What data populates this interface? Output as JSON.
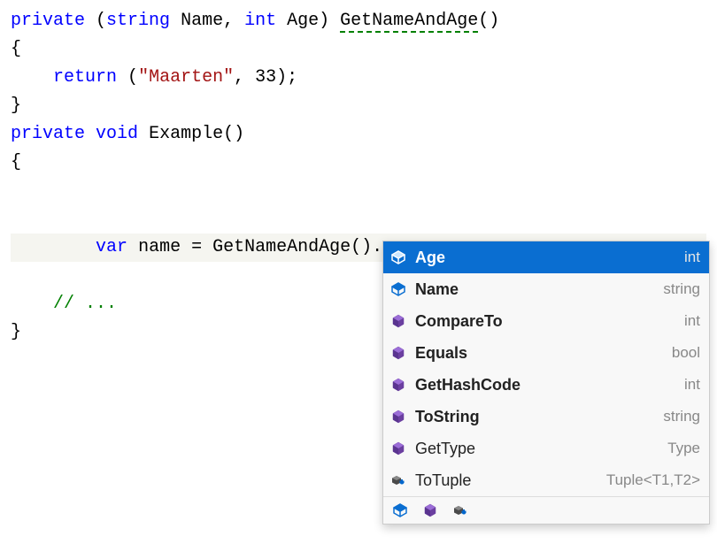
{
  "code": {
    "line1": {
      "kw_private": "private",
      "paren_open": "(",
      "type_string": "string",
      "name_label": "Name",
      "comma": ", ",
      "type_int": "int",
      "age_label": "Age",
      "paren_close": ") ",
      "method": "GetNameAndAge",
      "parens": "()"
    },
    "line2": "{",
    "line3": {
      "indent": "    ",
      "kw_return": "return",
      "space": " ",
      "paren_open": "(",
      "str": "\"Maarten\"",
      "comma": ", ",
      "num": "33",
      "paren_close": ");"
    },
    "line4": "}",
    "line5": "",
    "line6": {
      "kw_private": "private",
      "space": " ",
      "kw_void": "void",
      "space2": " ",
      "method": "Example",
      "parens": "()"
    },
    "line7": "{",
    "line8": {
      "indent": "    ",
      "kw_var": "var",
      "space": " ",
      "ident": "name",
      "eq": " = ",
      "call": "GetNameAndAge().",
      "squiggle": ""
    },
    "line9": "",
    "line10": {
      "indent": "    ",
      "comment": "// ..."
    },
    "line11": "}"
  },
  "intellisense": {
    "items": [
      {
        "icon": "field",
        "label": "Age",
        "type": "int",
        "bold": true,
        "selected": true
      },
      {
        "icon": "field",
        "label": "Name",
        "type": "string",
        "bold": true
      },
      {
        "icon": "method",
        "label": "CompareTo",
        "type": "int",
        "bold": true
      },
      {
        "icon": "method",
        "label": "Equals",
        "type": "bool",
        "bold": true
      },
      {
        "icon": "method",
        "label": "GetHashCode",
        "type": "int",
        "bold": true
      },
      {
        "icon": "method",
        "label": "ToString",
        "type": "string",
        "bold": true
      },
      {
        "icon": "method",
        "label": "GetType",
        "type": "Type",
        "bold": false
      },
      {
        "icon": "extension",
        "label": "ToTuple",
        "type": "Tuple<T1,T2>",
        "bold": false
      }
    ],
    "footer_icons": [
      "field",
      "method",
      "extension"
    ]
  }
}
